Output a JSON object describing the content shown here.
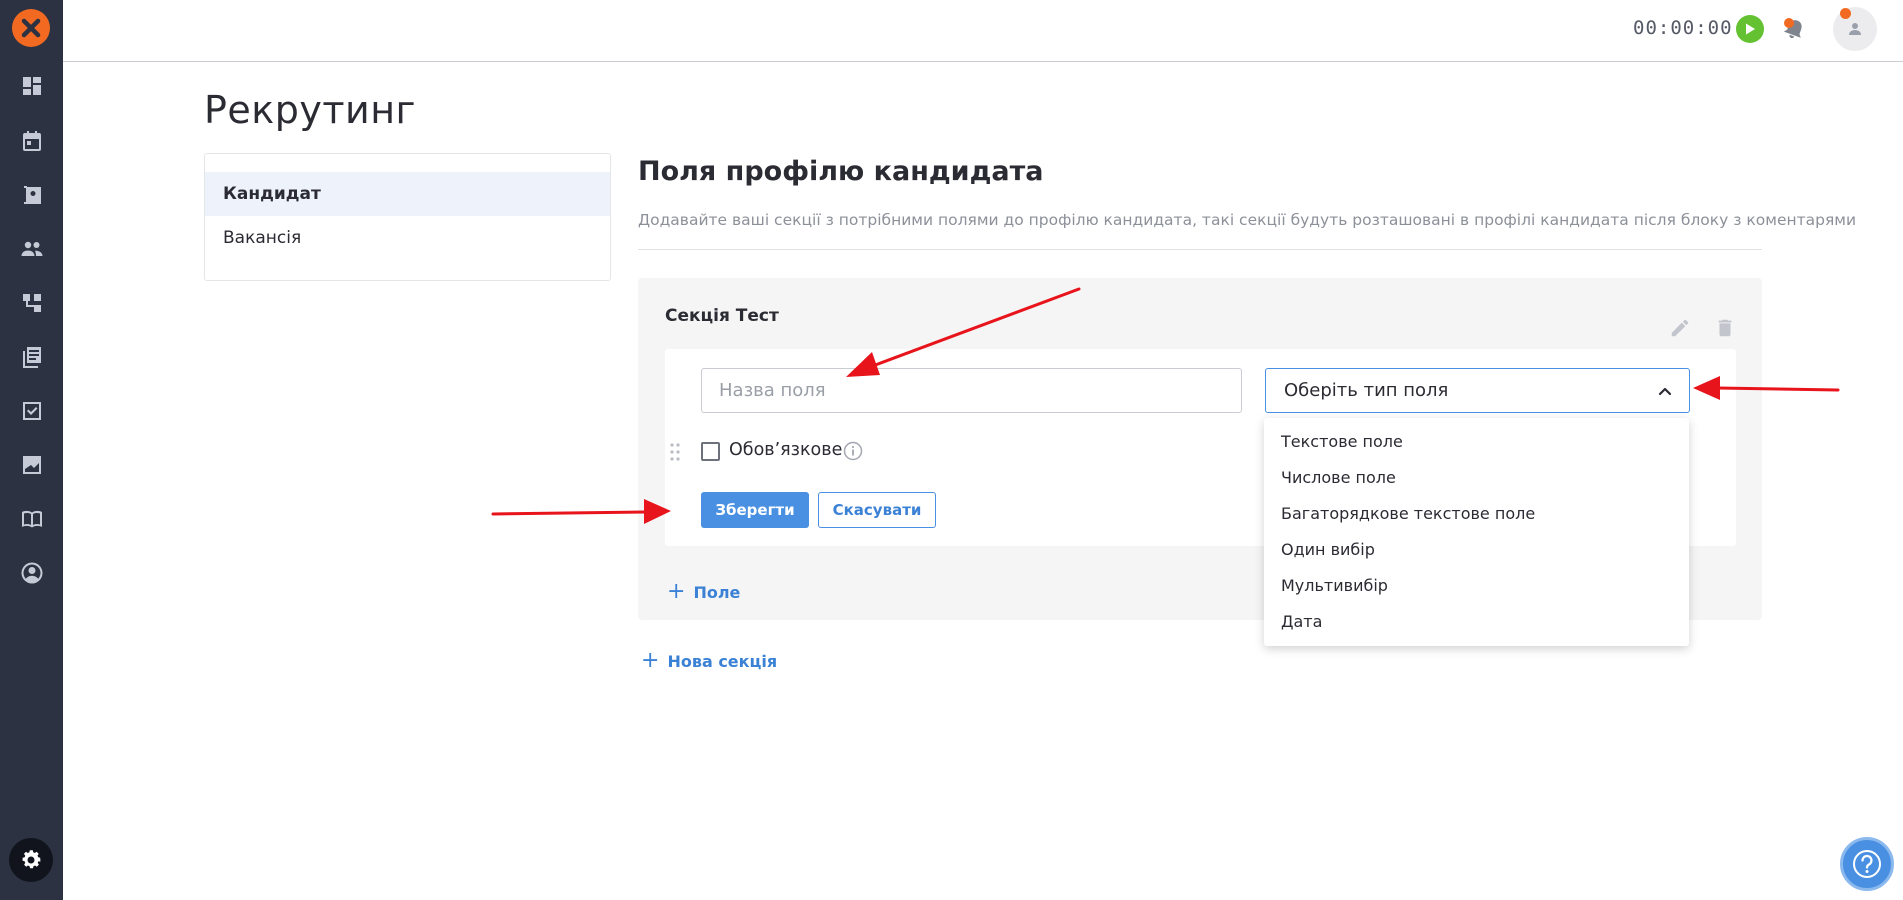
{
  "app": {
    "logo_icon": "close-x-logo"
  },
  "sidebar": {
    "items": [
      {
        "name": "dashboard-icon"
      },
      {
        "name": "calendar-icon"
      },
      {
        "name": "contacts-icon"
      },
      {
        "name": "people-icon"
      },
      {
        "name": "structure-icon"
      },
      {
        "name": "library-icon"
      },
      {
        "name": "checklist-icon"
      },
      {
        "name": "chart-icon"
      },
      {
        "name": "book-icon"
      },
      {
        "name": "profile-icon"
      }
    ],
    "settings_icon": "gear-icon"
  },
  "topbar": {
    "timer": "00:00:00",
    "play_icon": "play-icon",
    "notifications_icon": "bell-icon",
    "avatar_icon": "user-icon"
  },
  "page": {
    "title": "Рекрутинг",
    "nav": [
      {
        "label": "Кандидат",
        "active": true
      },
      {
        "label": "Вакансія",
        "active": false
      }
    ],
    "section_title": "Поля профілю кандидата",
    "section_description": "Додавайте ваші секції з потрібними полями до профілю кандидата, такі секції будуть розташовані в профілі кандидата після блоку з коментарями"
  },
  "card": {
    "title": "Секція Тест",
    "edit_icon": "pencil-icon",
    "delete_icon": "trash-icon",
    "field": {
      "name_placeholder": "Назва поля",
      "name_value": "",
      "type_placeholder": "Оберіть тип поля",
      "required_label": "Обов’язкове",
      "required_checked": false,
      "save_label": "Зберегти",
      "cancel_label": "Скасувати"
    },
    "add_field_label": "Поле",
    "type_options": [
      "Текстове поле",
      "Числове поле",
      "Багаторядкове текстове поле",
      "Один вибір",
      "Мультивибір",
      "Дата"
    ]
  },
  "add_section_label": "Нова секція",
  "help_icon": "question-icon",
  "colors": {
    "sidebar_bg": "#2c3242",
    "accent": "#4a90e2",
    "brand_orange": "#f26a21",
    "play_green": "#63c132",
    "annotation_red": "#e8141b"
  }
}
